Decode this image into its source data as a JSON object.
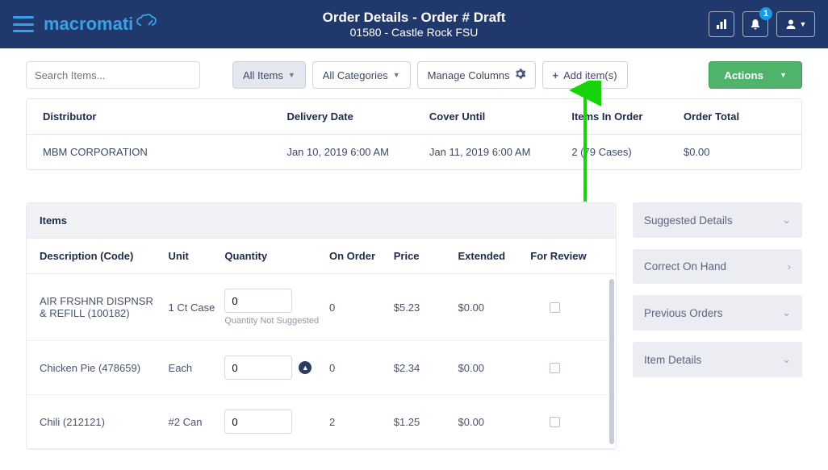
{
  "header": {
    "title": "Order Details - Order # Draft",
    "subtitle": "01580 - Castle Rock FSU",
    "brand_prefix": "macromati",
    "brand_suffix": "X",
    "notification_count": "1"
  },
  "toolbar": {
    "search_placeholder": "Search Items...",
    "all_items": "All Items",
    "all_categories": "All Categories",
    "manage_columns": "Manage Columns",
    "add_items": "Add item(s)",
    "actions": "Actions"
  },
  "summary": {
    "headers": {
      "distributor": "Distributor",
      "delivery_date": "Delivery Date",
      "cover_until": "Cover Until",
      "items_in_order": "Items In Order",
      "order_total": "Order Total"
    },
    "row": {
      "distributor": "MBM CORPORATION",
      "delivery_date": "Jan 10, 2019 6:00 AM",
      "cover_until": "Jan 11, 2019 6:00 AM",
      "items_in_order": "2 (79 Cases)",
      "order_total": "$0.00"
    }
  },
  "items": {
    "title": "Items",
    "headers": {
      "description": "Description (Code)",
      "unit": "Unit",
      "quantity": "Quantity",
      "on_order": "On Order",
      "price": "Price",
      "extended": "Extended",
      "for_review": "For Review"
    },
    "rows": [
      {
        "description": "AIR FRSHNR DISPNSR & REFILL (100182)",
        "unit": "1 Ct Case",
        "quantity": "0",
        "quantity_note": "Quantity Not Suggested",
        "on_order": "0",
        "price": "$5.23",
        "extended": "$0.00"
      },
      {
        "description": "Chicken Pie (478659)",
        "unit": "Each",
        "quantity": "0",
        "on_order": "0",
        "price": "$2.34",
        "extended": "$0.00"
      },
      {
        "description": "Chili (212121)",
        "unit": "#2 Can",
        "quantity": "0",
        "on_order": "2",
        "price": "$1.25",
        "extended": "$0.00"
      }
    ]
  },
  "side": {
    "suggested": "Suggested Details",
    "correct": "Correct On Hand",
    "previous": "Previous Orders",
    "item_details": "Item Details"
  }
}
